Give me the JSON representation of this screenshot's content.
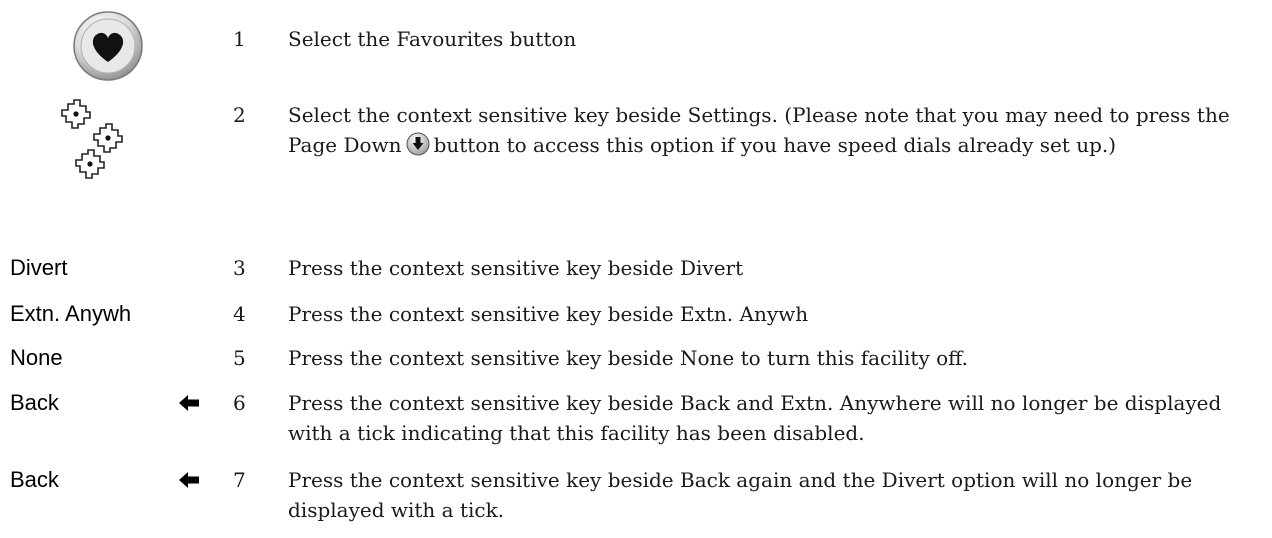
{
  "icons": {
    "step1": "favourites-heart-icon",
    "step2": "context-sensitive-keys-icon",
    "page_down": "page-down-icon",
    "back": "back-arrow-icon"
  },
  "steps": [
    {
      "label": "",
      "num": "1",
      "text": "Select the Favourites button"
    },
    {
      "label": "",
      "num": "2",
      "text_before": "Select the context sensitive key beside Settings.  (Please note that you may need to press the Page Down",
      "text_after": "button to access this option if you have speed dials already set up.)"
    },
    {
      "label": "Divert",
      "num": "3",
      "text": "Press the context sensitive key beside Divert"
    },
    {
      "label": "Extn. Anywh",
      "num": "4",
      "text": "Press the context sensitive key beside Extn. Anywh"
    },
    {
      "label": "None",
      "num": "5",
      "text": "Press the context sensitive key beside None to turn this facility off."
    },
    {
      "label": "Back",
      "num": "6",
      "text": "Press the context sensitive key beside Back and Extn. Anywhere will no longer be displayed with a tick indicating that this facility has been disabled."
    },
    {
      "label": "Back",
      "num": "7",
      "text": "Press the context sensitive key beside Back again and the Divert option will no longer be displayed with a tick."
    }
  ]
}
